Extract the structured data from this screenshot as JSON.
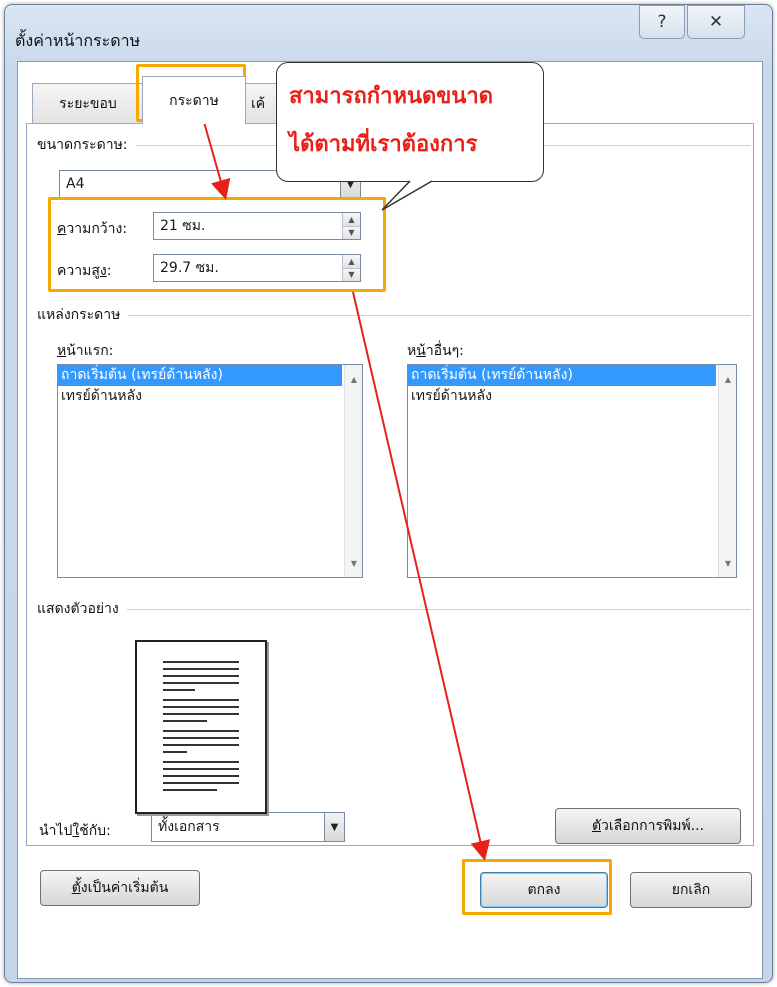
{
  "window": {
    "title": "ตั้งค่าหน้ากระดาษ",
    "help_glyph": "?",
    "close_glyph": "✕"
  },
  "tabs": [
    {
      "label": "ระยะขอบ",
      "active": false
    },
    {
      "label": "กระดาษ",
      "active": true
    },
    {
      "label": "เค้",
      "active": false
    }
  ],
  "paper_size": {
    "section_label": "ขนาดกระดาษ:",
    "selected": "A4",
    "width_label_ul": "ค",
    "width_label_rest": "วามกว้าง:",
    "width_value": "21 ซม.",
    "height_label_pre": "ความสู",
    "height_label_ul": "ง",
    "height_label_post": ":",
    "height_value": "29.7 ซม."
  },
  "paper_source": {
    "section_label": "แหล่งกระดาษ",
    "first_page_label_ul": "ห",
    "first_page_label_rest": "น้าแรก:",
    "first_page_items": [
      "ถาดเริ่มต้น (เทรย์ด้านหลัง)",
      "เทรย์ด้านหลัง"
    ],
    "other_pages_label_pre": "ห",
    "other_pages_label_ul": "น้",
    "other_pages_label_post": "าอื่นๆ:",
    "other_pages_items": [
      "ถาดเริ่มต้น (เทรย์ด้านหลัง)",
      "เทรย์ด้านหลัง"
    ]
  },
  "preview": {
    "section_label": "แสดงตัวอย่าง"
  },
  "apply": {
    "label_pre": "นำไป",
    "label_ul": "ใ",
    "label_post": "ช้กับ:",
    "selected": "ทั้งเอกสาร",
    "print_options_ul": "ตั",
    "print_options_rest": "วเลือกการพิมพ์..."
  },
  "footer": {
    "set_default_ul": "ตั้",
    "set_default_rest": "งเป็นค่าเริ่มต้น",
    "ok": "ตกลง",
    "cancel": "ยกเลิก"
  },
  "annotation": {
    "line1": "สามารถกำหนดขนาด",
    "line2": "ได้ตามที่เราต้องการ",
    "highlight_color": "#f2a900",
    "arrow_color": "#e8201a"
  }
}
